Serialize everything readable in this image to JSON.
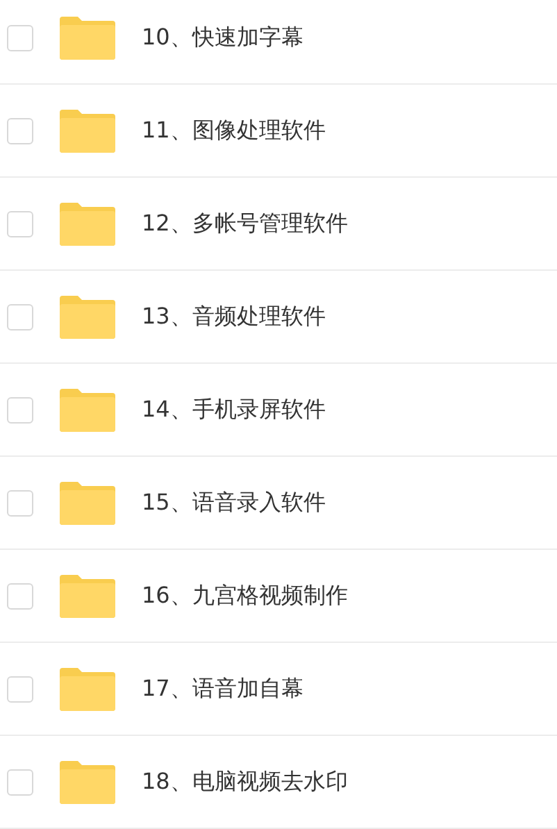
{
  "files": [
    {
      "name": "10、快速加字幕",
      "checked": false
    },
    {
      "name": "11、图像处理软件",
      "checked": false
    },
    {
      "name": "12、多帐号管理软件",
      "checked": false
    },
    {
      "name": "13、音频处理软件",
      "checked": false
    },
    {
      "name": "14、手机录屏软件",
      "checked": false
    },
    {
      "name": "15、语音录入软件",
      "checked": false
    },
    {
      "name": "16、九宫格视频制作",
      "checked": false
    },
    {
      "name": "17、语音加自幕",
      "checked": false
    },
    {
      "name": "18、电脑视频去水印",
      "checked": false
    }
  ]
}
